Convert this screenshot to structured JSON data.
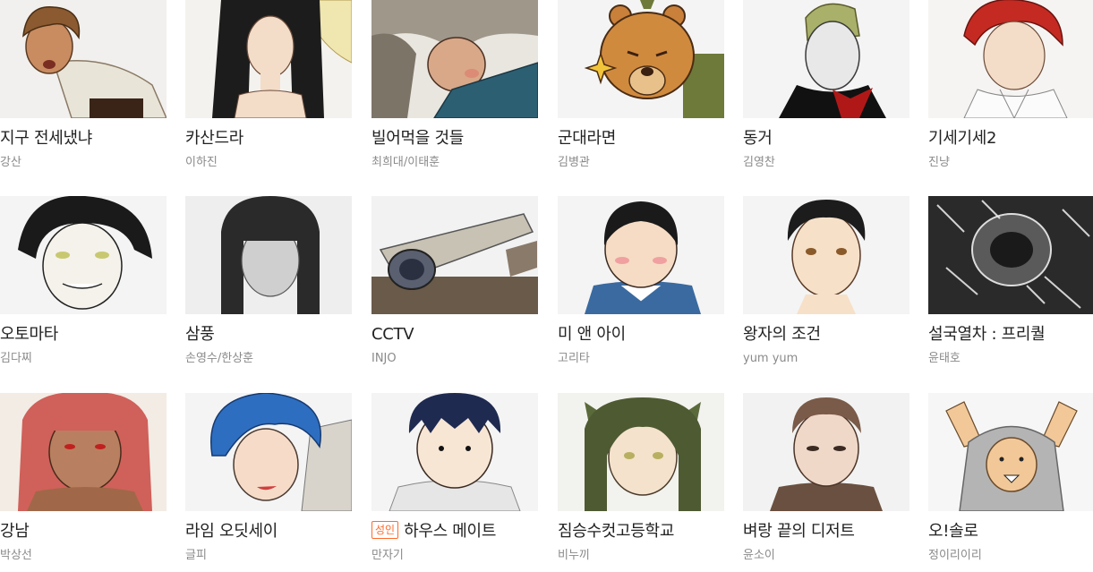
{
  "webtoons": [
    {
      "title": "지구 전세냈냐",
      "author": "강산",
      "icon": "boy-leaning-forward-thumbnail"
    },
    {
      "title": "카산드라",
      "author": "이하진",
      "icon": "long-black-hair-woman-thumbnail"
    },
    {
      "title": "빌어먹을 것들",
      "author": "최희대/이태훈",
      "icon": "wild-grey-hair-man-thumbnail"
    },
    {
      "title": "군대라면",
      "author": "김병관",
      "icon": "angry-bear-thumbnail"
    },
    {
      "title": "동거",
      "author": "김영찬",
      "icon": "pale-man-green-hair-thumbnail"
    },
    {
      "title": "기세기세2",
      "author": "진냥",
      "icon": "red-hair-boy-thumbnail"
    },
    {
      "title": "오토마타",
      "author": "김다찌",
      "icon": "black-hair-grinning-boy-thumbnail"
    },
    {
      "title": "삼풍",
      "author": "손영수/한상훈",
      "icon": "bob-hair-girl-thumbnail"
    },
    {
      "title": "CCTV",
      "author": "INJO",
      "icon": "cctv-camera-thumbnail"
    },
    {
      "title": "미 앤 아이",
      "author": "고리타",
      "icon": "blushing-boy-thumbnail"
    },
    {
      "title": "왕자의 조건",
      "author": "yum yum",
      "icon": "prince-boy-thumbnail"
    },
    {
      "title": "설국열차 : 프리퀄",
      "author": "윤태호",
      "icon": "snowstorm-figure-thumbnail"
    },
    {
      "title": "강남",
      "author": "박상선",
      "icon": "pink-hair-woman-thumbnail"
    },
    {
      "title": "라임 오딧세이",
      "author": "글피",
      "icon": "blue-hair-boy-thumbnail"
    },
    {
      "title": "하우스 메이트",
      "author": "만자기",
      "badge": "성인",
      "icon": "navy-hair-boy-thumbnail"
    },
    {
      "title": "짐승수컷고등학교",
      "author": "비누끼",
      "icon": "cat-ear-boy-thumbnail"
    },
    {
      "title": "벼랑 끝의 디저트",
      "author": "윤소이",
      "icon": "short-hair-man-thumbnail"
    },
    {
      "title": "오!솔로",
      "author": "정이리이리",
      "icon": "hooded-figure-arms-up-thumbnail"
    }
  ],
  "colors": {
    "title": "#222222",
    "author": "#8a8a8a",
    "badge": "#ff6a2b"
  }
}
